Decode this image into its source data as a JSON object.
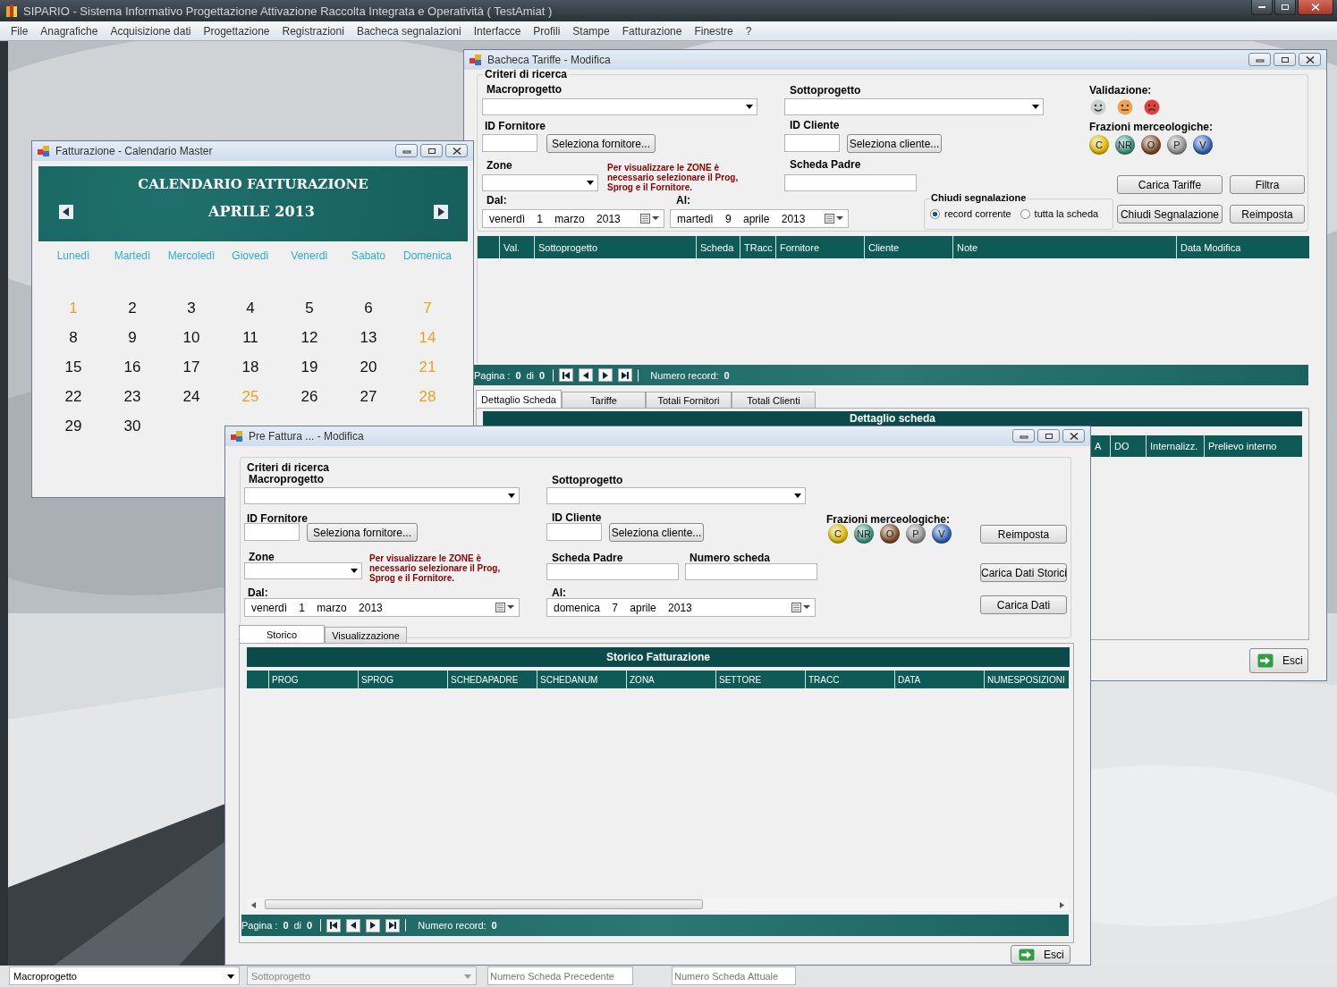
{
  "app": {
    "title": "SIPARIO - Sistema Informativo Progettazione Attivazione Raccolta Integrata e Operatività ( TestAmiat )",
    "menu": [
      "File",
      "Anagrafiche",
      "Acquisizione dati",
      "Progettazione",
      "Registrazioni",
      "Bacheca segnalazioni",
      "Interfacce",
      "Profili",
      "Stampe",
      "Fatturazione",
      "Finestre",
      "?"
    ]
  },
  "calendar_window": {
    "title": "Fatturazione - Calendario Master",
    "heading": "CALENDARIO FATTURAZIONE",
    "month": "APRILE 2013",
    "weekdays": [
      "Lunedì",
      "Martedì",
      "Mercoledì",
      "Giovedì",
      "Venerdì",
      "Sabato",
      "Domenica"
    ],
    "days": [
      {
        "label": "1",
        "holiday": true
      },
      {
        "label": "2",
        "holiday": false
      },
      {
        "label": "3",
        "holiday": false
      },
      {
        "label": "4",
        "holiday": false
      },
      {
        "label": "5",
        "holiday": false
      },
      {
        "label": "6",
        "holiday": false
      },
      {
        "label": "7",
        "holiday": true
      },
      {
        "label": "8",
        "holiday": false
      },
      {
        "label": "9",
        "holiday": false
      },
      {
        "label": "10",
        "holiday": false
      },
      {
        "label": "11",
        "holiday": false
      },
      {
        "label": "12",
        "holiday": false
      },
      {
        "label": "13",
        "holiday": false
      },
      {
        "label": "14",
        "holiday": true
      },
      {
        "label": "15",
        "holiday": false
      },
      {
        "label": "16",
        "holiday": false
      },
      {
        "label": "17",
        "holiday": false
      },
      {
        "label": "18",
        "holiday": false
      },
      {
        "label": "19",
        "holiday": false
      },
      {
        "label": "20",
        "holiday": false
      },
      {
        "label": "21",
        "holiday": true
      },
      {
        "label": "22",
        "holiday": false
      },
      {
        "label": "23",
        "holiday": false
      },
      {
        "label": "24",
        "holiday": false
      },
      {
        "label": "25",
        "holiday": true
      },
      {
        "label": "26",
        "holiday": false
      },
      {
        "label": "27",
        "holiday": false
      },
      {
        "label": "28",
        "holiday": true
      },
      {
        "label": "29",
        "holiday": false
      },
      {
        "label": "30",
        "holiday": false
      }
    ]
  },
  "bacheca_window": {
    "title": "Bacheca Tariffe - Modifica",
    "criteria": {
      "title": "Criteri di ricerca",
      "macroprogetto_label": "Macroprogetto",
      "sottoprogetto_label": "Sottoprogetto",
      "id_fornitore_label": "ID Fornitore",
      "seleziona_fornitore": "Seleziona fornitore...",
      "id_cliente_label": "ID Cliente",
      "seleziona_cliente": "Seleziona cliente...",
      "zone_label": "Zone",
      "zone_note": "Per visualizzare le ZONE è necessario selezionare il Prog, Sprog e il Fornitore.",
      "scheda_padre_label": "Scheda Padre",
      "dal_label": "Dal:",
      "dal": "venerdì 1 marzo 2013",
      "al_label": "Al:",
      "al": "martedì 9 aprile 2013",
      "validazione_label": "Validazione:",
      "frazioni_label": "Frazioni merceologiche:",
      "frazioni": [
        {
          "label": "C",
          "color": "#d8b400"
        },
        {
          "label": "NR",
          "color": "#3d8f7c"
        },
        {
          "label": "O",
          "color": "#7a4a26"
        },
        {
          "label": "P",
          "color": "#8c8c8c"
        },
        {
          "label": "V",
          "color": "#2f5fae"
        }
      ],
      "chiudi_segnalazione": {
        "title": "Chiudi segnalazione",
        "options": [
          {
            "label": "record corrente",
            "selected": true
          },
          {
            "label": "tutta la scheda",
            "selected": false
          }
        ]
      },
      "buttons": [
        "Carica Tariffe",
        "Filtra",
        "Chiudi Segnalazione",
        "Reimposta"
      ]
    },
    "grid_columns": [
      "Val.",
      "Sottoprogetto",
      "Scheda",
      "TRacc",
      "Fornitore",
      "Cliente",
      "Note",
      "Data Modifica"
    ],
    "pager": {
      "pagina_label": "Pagina :",
      "page": "0",
      "di": "di",
      "total": "0",
      "record_label": "Numero record:",
      "records": "0"
    },
    "tabs": [
      {
        "label": "Dettaglio Scheda",
        "selected": true
      },
      {
        "label": "Tariffe",
        "selected": false
      },
      {
        "label": "Totali Fornitori",
        "selected": false
      },
      {
        "label": "Totali Clienti",
        "selected": false
      }
    ],
    "detail_title": "Dettaglio scheda",
    "detail_columns": [
      "A",
      "DO",
      "Internalizz.",
      "Prelievo interno"
    ],
    "esci": "Esci"
  },
  "prefattura_window": {
    "title": "Pre Fattura ... - Modifica",
    "criteria": {
      "title": "Criteri di ricerca",
      "macroprogetto_label": "Macroprogetto",
      "sottoprogetto_label": "Sottoprogetto",
      "id_fornitore_label": "ID Fornitore",
      "seleziona_fornitore": "Seleziona fornitore...",
      "id_cliente_label": "ID Cliente",
      "seleziona_cliente": "Seleziona cliente...",
      "frazioni_label": "Frazioni merceologiche:",
      "frazioni": [
        {
          "label": "C",
          "color": "#d8b400"
        },
        {
          "label": "NR",
          "color": "#3d8f7c"
        },
        {
          "label": "O",
          "color": "#7a4a26"
        },
        {
          "label": "P",
          "color": "#8c8c8c"
        },
        {
          "label": "V",
          "color": "#2f5fae"
        }
      ],
      "zone_label": "Zone",
      "zone_note": "Per visualizzare le ZONE è necessario selezionare il Prog, Sprog e il Fornitore.",
      "scheda_padre_label": "Scheda Padre",
      "numero_scheda_label": "Numero scheda",
      "dal_label": "Dal:",
      "dal": "venerdì 1 marzo 2013",
      "al_label": "Al:",
      "al": "domenica 7 aprile 2013",
      "buttons": [
        "Reimposta",
        "Carica Dati Storici",
        "Carica Dati"
      ]
    },
    "tabs": [
      {
        "label": "Storico",
        "selected": true
      },
      {
        "label": "Visualizzazione",
        "selected": false
      }
    ],
    "grid_title": "Storico Fatturazione",
    "grid_columns": [
      "PROG",
      "SPROG",
      "SCHEDAPADRE",
      "SCHEDANUM",
      "ZONA",
      "SETTORE",
      "TRACC",
      "DATA",
      "NUMESPOSIZIONI"
    ],
    "pager": {
      "pagina_label": "Pagina :",
      "page": "0",
      "di": "di",
      "total": "0",
      "record_label": "Numero record:",
      "records": "0"
    },
    "esci": "Esci"
  },
  "bottom_bar": {
    "macroprogetto": {
      "value": "Macroprogetto",
      "disabled": false
    },
    "sottoprogetto": {
      "value": "Sottoprogetto",
      "disabled": true
    },
    "numero_precedente": {
      "placeholder": "Numero Scheda Precedente"
    },
    "numero_attuale": {
      "placeholder": "Numero Scheda Attuale"
    }
  }
}
